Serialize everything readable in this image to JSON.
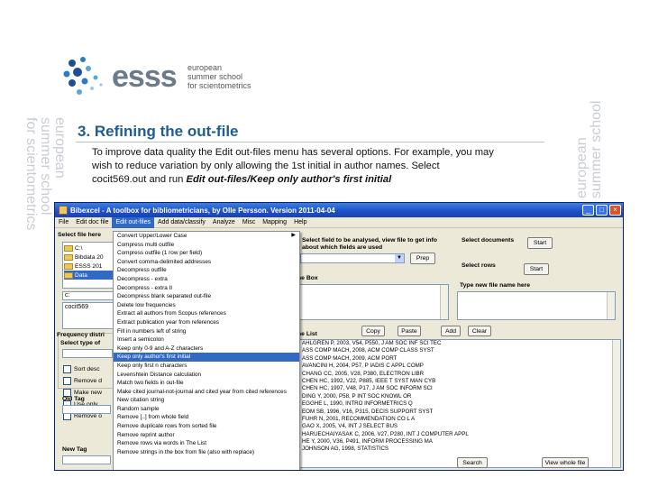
{
  "slide": {
    "logo_word": "esss",
    "logo_sub": [
      "european",
      "summer school",
      "for scientometrics"
    ],
    "watermark": [
      "european",
      "summer school",
      "for scientometrics"
    ],
    "title": "3. Refining the out-file",
    "body_line1": "To improve data quality the Edit out-files menu has several options. For example, you may",
    "body_line2": "wish to reduce variation  by only allowing the 1st initial in author names. Select",
    "body_line3_prefix": "cocit569.out and run ",
    "body_line3_bold": "Edit out-files/Keep only author's first initial"
  },
  "window": {
    "title": "Bibexcel - A toolbox for bibliometricians, by Olle Persson. Version 2011-04-04",
    "menu": [
      "File",
      "Edit doc file",
      "Edit out-files",
      "Add data/classify",
      "Analyze",
      "Misc",
      "Mapping",
      "Help"
    ],
    "active_menu_index": 2
  },
  "left": {
    "select_file_label": "Select file here",
    "folders": [
      {
        "name": "C:\\",
        "selected": false
      },
      {
        "name": "Bibdata 20",
        "selected": false
      },
      {
        "name": "ESSS 201",
        "selected": false
      },
      {
        "name": "Data",
        "selected": true
      }
    ],
    "drive_value": "c:",
    "file_value": "cocit569",
    "freq_label": "Frequency distri",
    "select_type_label": "Select type of",
    "checkbox_labels": [
      "Sort desc",
      "Remove d",
      "Make new",
      "Use only",
      "Remove o"
    ],
    "old_tag_label": "Old Tag",
    "new_tag_label": "New Tag"
  },
  "dropdown": {
    "items": [
      {
        "label": "Convert Upper/Lower Case",
        "submenu": true
      },
      {
        "label": "Compress multi outfile"
      },
      {
        "label": "Compress outfile (1 row per field)"
      },
      {
        "label": "Convert comma-delimited addresses"
      },
      {
        "label": "Decompress outfile"
      },
      {
        "label": "Decompress - extra"
      },
      {
        "label": "Decompress - extra II"
      },
      {
        "label": "Decompress blank separated out-file"
      },
      {
        "label": "Delete low frequencies"
      },
      {
        "label": "Extract all authors from Scopus references"
      },
      {
        "label": "Extract publication year from references"
      },
      {
        "label": "Fill in numbers left of string"
      },
      {
        "label": "Insert a semicolon"
      },
      {
        "label": "Keep only 0-9 and A-Z characters"
      },
      {
        "label": "Keep only author's first initial",
        "highlight": true
      },
      {
        "label": "Keep only first n characters"
      },
      {
        "label": "Levenshtein Distance calculation"
      },
      {
        "label": "Match two fields in out-file"
      },
      {
        "label": "Make cited journal-not-journal and cited year from cited references"
      },
      {
        "label": "New citation string"
      },
      {
        "label": "Random sample"
      },
      {
        "label": "Remove [..] from whole field"
      },
      {
        "label": "Remove duplicate rows from sorted file"
      },
      {
        "label": "Remove reprint author"
      },
      {
        "label": "Remove rows via words in The List"
      },
      {
        "label": "Remove strings in the box from file (also with replace)"
      }
    ]
  },
  "right": {
    "info_line1": "Select field to be analysed, view file to get info",
    "info_line2": "about which fields are used",
    "prep_button": "Prep",
    "select_docs_label": "Select documents",
    "start_button1": "Start",
    "select_rows_label": "Select rows",
    "start_button2": "Start",
    "the_box_label": "he Box",
    "new_file_label": "Type new file name here",
    "copy_button": "Copy",
    "paste_button": "Paste",
    "add_button": "Add",
    "clear_button": "Clear",
    "the_list_label": "he List",
    "list_rows": [
      "AHLGREN P, 2003, V54, P550, J AM SOC INF SCI TEC",
      "ASS COMP MACH, 2008, ACM COMP CLASS SYST",
      "ASS COMP MACH, 2009, ACM PORT",
      "AVANCINI H, 2004, P57, P IADIS C APPL COMP",
      "CHANG CC, 2005, V28, P380, ELECTRON LIBR",
      "CHEN HC, 1992, V22, P885, IEEE T SYST MAN CYB",
      "CHEN HC, 1997, V48, P17, J AM SOC INFORM SCI",
      "DING Y, 2000, P58, P INT SOC KNOWL OR",
      "EGGHE L, 1990, INTRO INFORMETRICS Q",
      "EOM SB, 1996, V16, P315, DECIS SUPPORT SYST",
      "FUHR N, 2001, RECOMMENDATION CO L A",
      "GAO X, 2005, V4, INT J SELECT BUS",
      "HARUECHAIYASAK C, 2006, V27, P280, INT J COMPUTER APPL",
      "HE Y, 2000, V36, P491, INFORM PROCESSING MA",
      "JOHNSON AG, 1998, STATISTICS"
    ],
    "search_button": "Search",
    "view_whole_button": "View whole file"
  }
}
